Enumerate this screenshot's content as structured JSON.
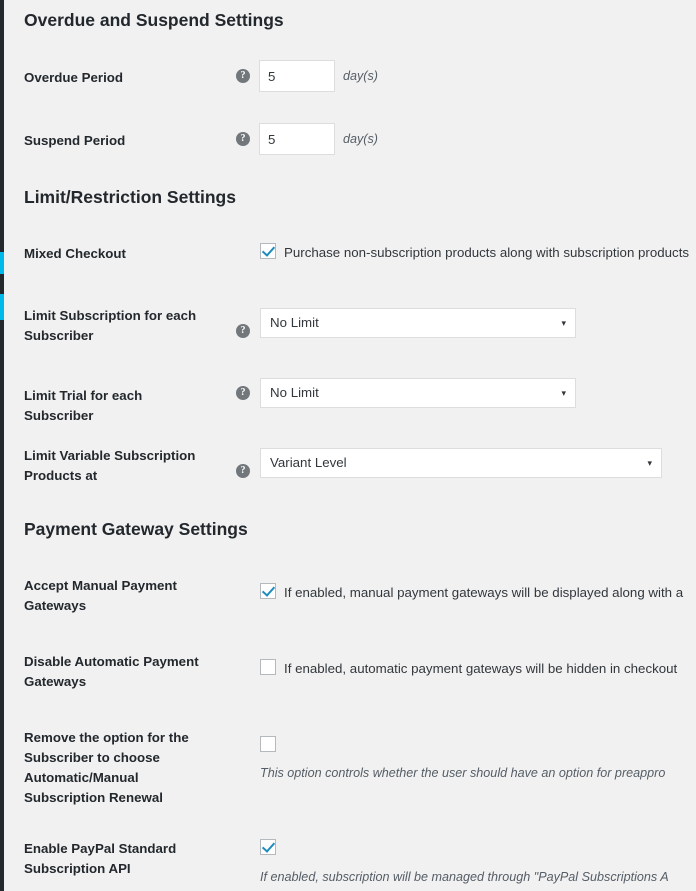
{
  "theme": {
    "page_background": "#f1f1f1",
    "rail_color": "#23282d",
    "rail_accent_color": "#00b9eb",
    "checkbox_check_color": "#1e8cbe",
    "text_color": "#23282d",
    "muted_text_color": "#555d66",
    "field_border_color": "#dddddd"
  },
  "icons": {
    "help": "?",
    "select_arrow": "▾"
  },
  "sections": [
    {
      "id": "overdue-and-suspend-settings",
      "heading": "Overdue and Suspend Settings",
      "fields": [
        {
          "id": "overdue-period",
          "label": "Overdue Period",
          "control": "number",
          "value": "5",
          "unit": "day(s)",
          "has_help": true
        },
        {
          "id": "suspend-period",
          "label": "Suspend Period",
          "control": "number",
          "value": "5",
          "unit": "day(s)",
          "has_help": true
        }
      ]
    },
    {
      "id": "limit-restriction-settings",
      "heading": "Limit/Restriction Settings",
      "fields": [
        {
          "id": "mixed-checkout",
          "label": "Mixed Checkout",
          "control": "checkbox",
          "checked": true,
          "checkbox_text": "Purchase non-subscription products along with subscription products",
          "has_help": false
        },
        {
          "id": "limit-subscription-for-each-subscriber",
          "label": "Limit Subscription for each Subscriber",
          "control": "select",
          "value": "No Limit",
          "has_help": true
        },
        {
          "id": "limit-trial-for-each-subscriber",
          "label": "Limit Trial for each Subscriber",
          "control": "select",
          "value": "No Limit",
          "has_help": true
        },
        {
          "id": "limit-variable-subscription-products-at",
          "label": "Limit Variable Subscription Products at",
          "control": "select",
          "value": "Variant Level",
          "has_help": true
        }
      ]
    },
    {
      "id": "payment-gateway-settings",
      "heading": "Payment Gateway Settings",
      "fields": [
        {
          "id": "accept-manual-payment-gateways",
          "label": "Accept Manual Payment Gateways",
          "control": "checkbox",
          "checked": true,
          "checkbox_text": "If enabled, manual payment gateways will be displayed along with a",
          "has_help": false
        },
        {
          "id": "disable-automatic-payment-gateways",
          "label": "Disable Automatic Payment Gateways",
          "control": "checkbox",
          "checked": false,
          "checkbox_text": "If enabled, automatic payment gateways will be hidden in checkout",
          "has_help": false
        },
        {
          "id": "remove-option-automatic-manual-subscription-renewal",
          "label": "Remove the option for the Subscriber to choose Automatic/Manual Subscription Renewal",
          "control": "checkbox",
          "checked": false,
          "description": "This option controls whether the user should have an option for preappro",
          "has_help": false
        },
        {
          "id": "enable-paypal-standard-subscription-api",
          "label": "Enable PayPal Standard Subscription API",
          "control": "checkbox",
          "checked": true,
          "description": "If enabled, subscription will be managed through \"PayPal Subscriptions A",
          "has_help": false
        }
      ]
    }
  ]
}
